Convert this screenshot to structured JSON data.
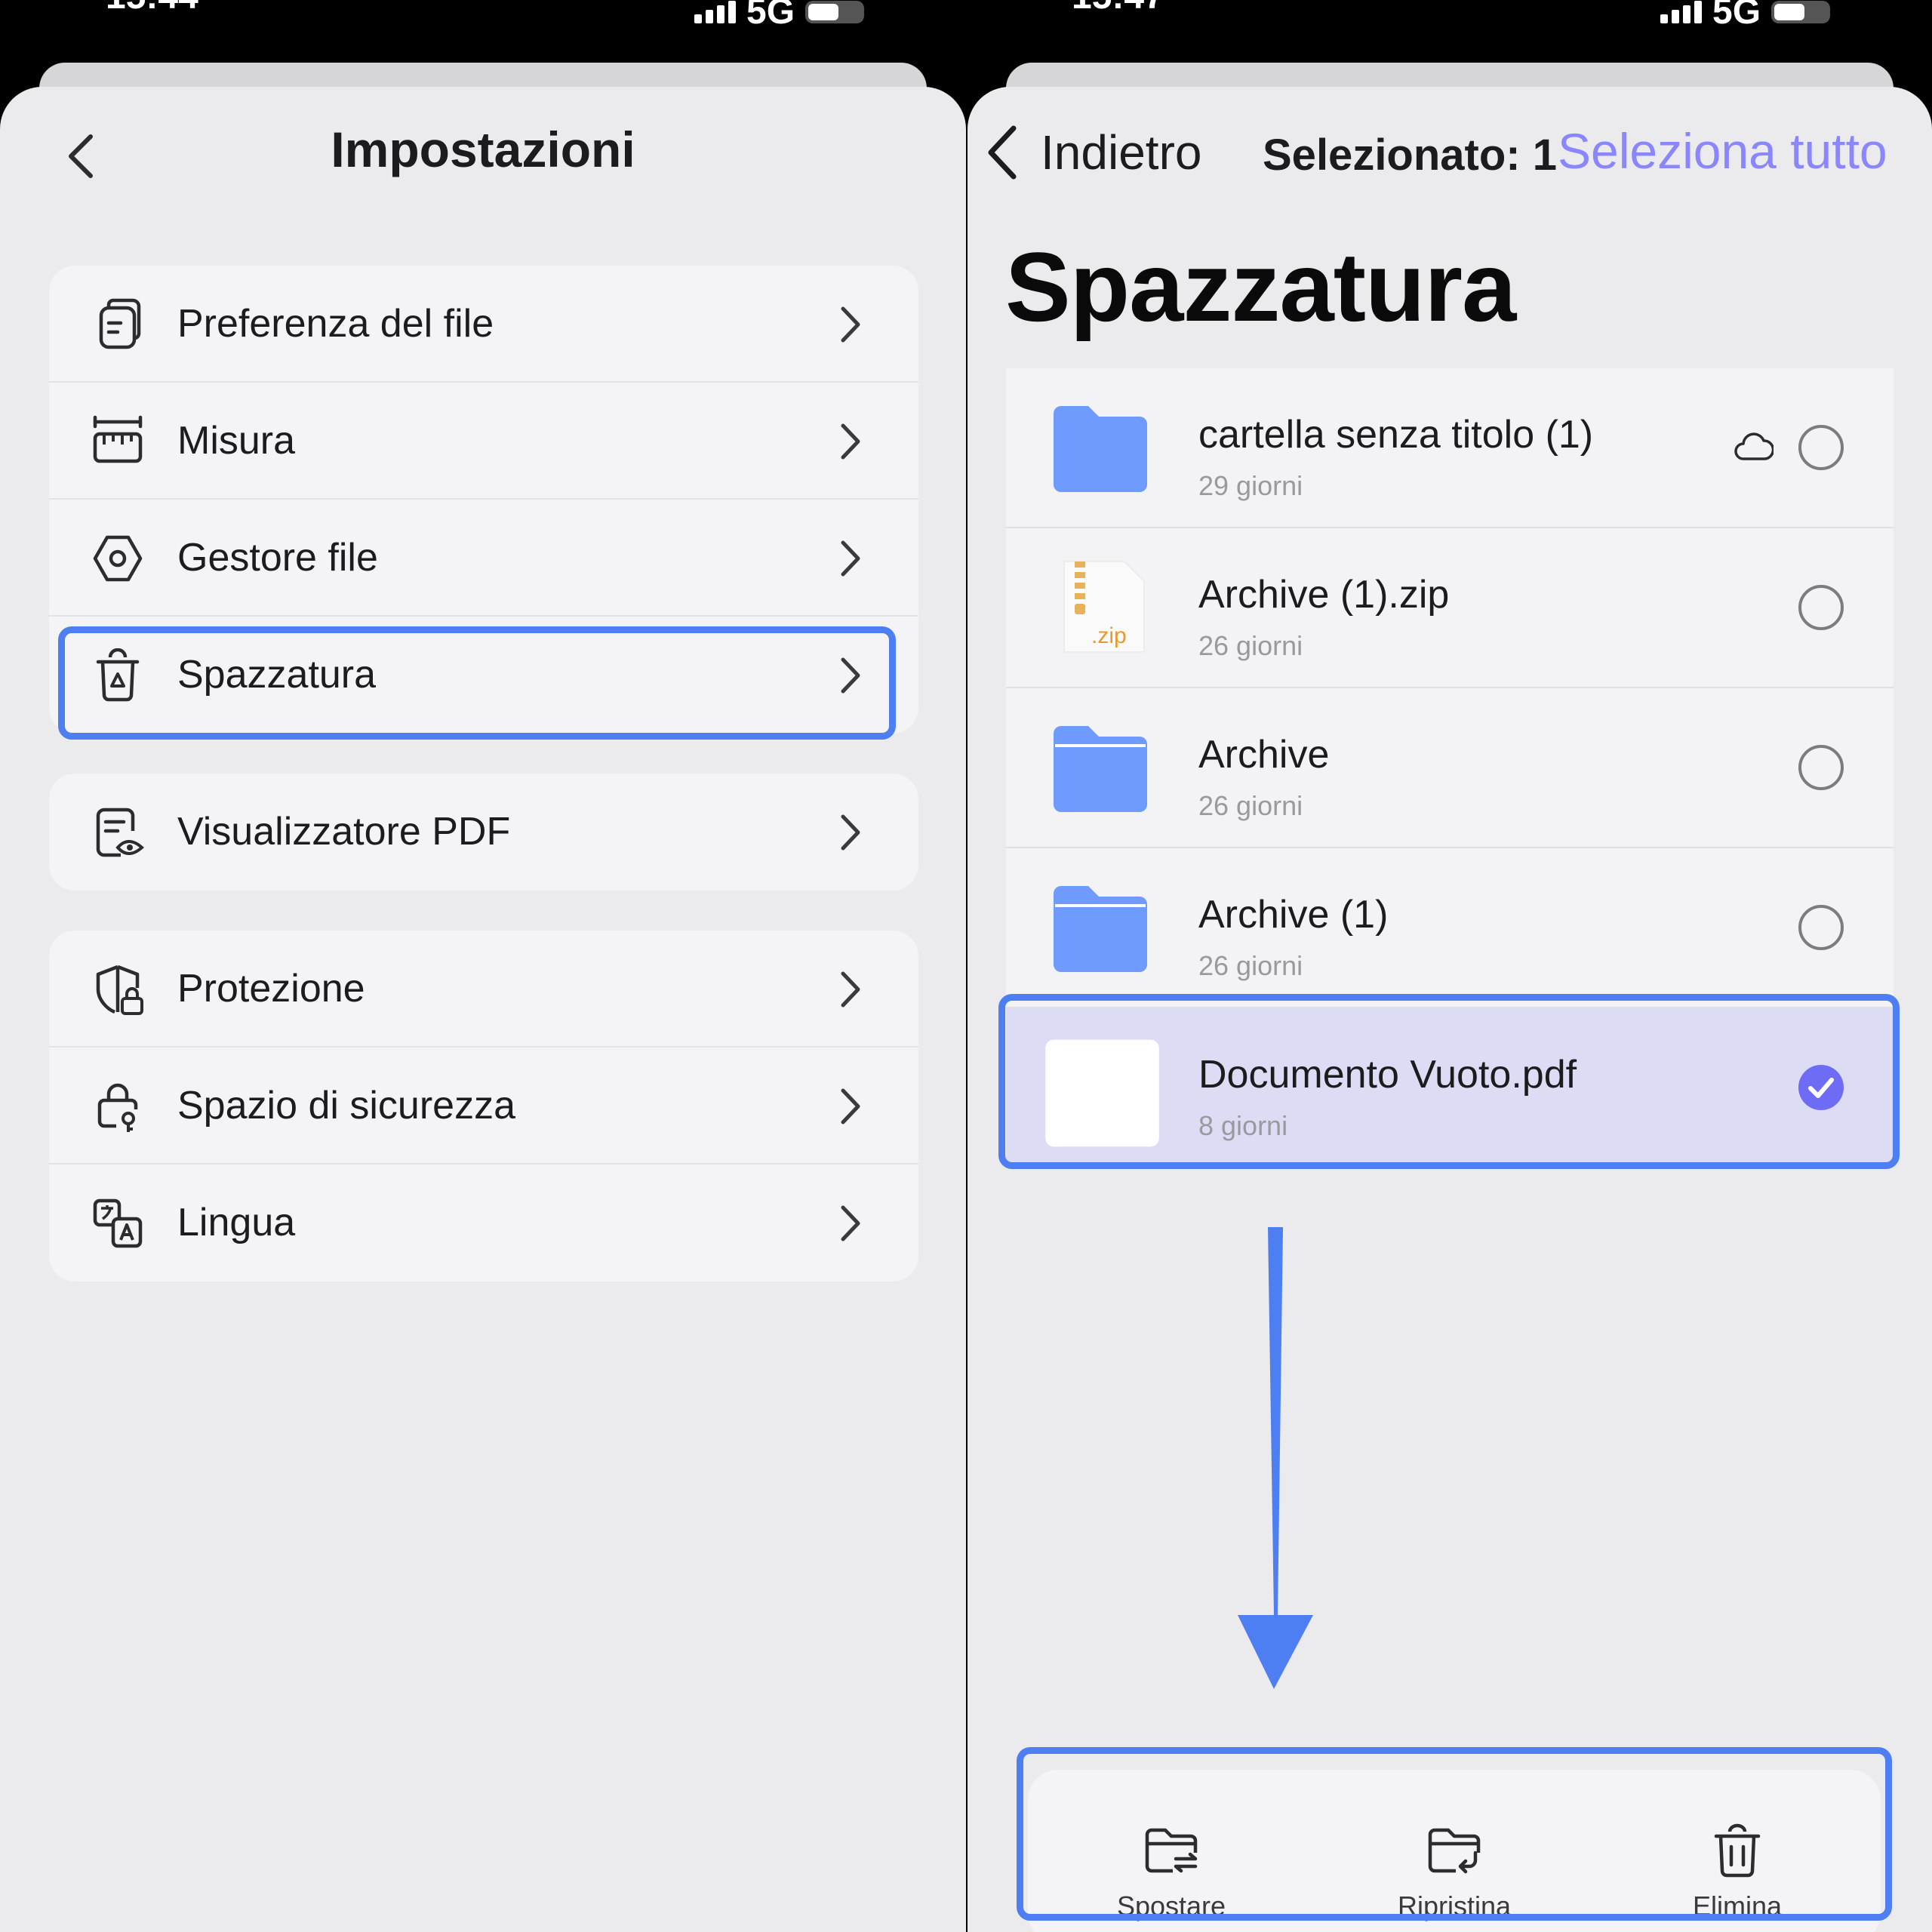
{
  "status_bar": {
    "left_time": "15:44",
    "right_time": "15:47",
    "network": "5G"
  },
  "settings": {
    "title": "Impostazioni",
    "groups": [
      [
        {
          "label": "Preferenza del file",
          "icon": "file-preference-icon"
        },
        {
          "label": "Misura",
          "icon": "ruler-icon"
        },
        {
          "label": "Gestore file",
          "icon": "hex-gear-icon"
        },
        {
          "label": "Spazzatura",
          "icon": "trash-icon"
        }
      ],
      [
        {
          "label": "Visualizzatore PDF",
          "icon": "pdf-viewer-icon"
        }
      ],
      [
        {
          "label": "Protezione",
          "icon": "shield-lock-icon"
        },
        {
          "label": "Spazio di sicurezza",
          "icon": "padlock-key-icon"
        },
        {
          "label": "Lingua",
          "icon": "translate-icon"
        }
      ]
    ]
  },
  "trash": {
    "back_label": "Indietro",
    "selected_label": "Selezionato: 1",
    "select_all_label": "Seleziona tutto",
    "title": "Spazzatura",
    "items": [
      {
        "name": "cartella senza titolo (1)",
        "age": "29 giorni",
        "type": "folder",
        "cloud": true,
        "selected": false
      },
      {
        "name": "Archive (1).zip",
        "age": "26 giorni",
        "type": "zip",
        "zip_label": ".zip",
        "cloud": false,
        "selected": false
      },
      {
        "name": "Archive",
        "age": "26 giorni",
        "type": "folder",
        "cloud": false,
        "selected": false
      },
      {
        "name": "Archive (1)",
        "age": "26 giorni",
        "type": "folder",
        "cloud": false,
        "selected": false
      },
      {
        "name": "Documento Vuoto.pdf",
        "age": "8 giorni",
        "type": "pdf",
        "cloud": false,
        "selected": true
      }
    ],
    "toolbar": {
      "move_label": "Spostare",
      "restore_label": "Ripristina",
      "delete_label": "Elimina"
    }
  },
  "colors": {
    "accent": "#8a86ff",
    "highlight": "#4d7ff2",
    "checkbox": "#6e6cf5",
    "folder": "#6f9bff"
  }
}
